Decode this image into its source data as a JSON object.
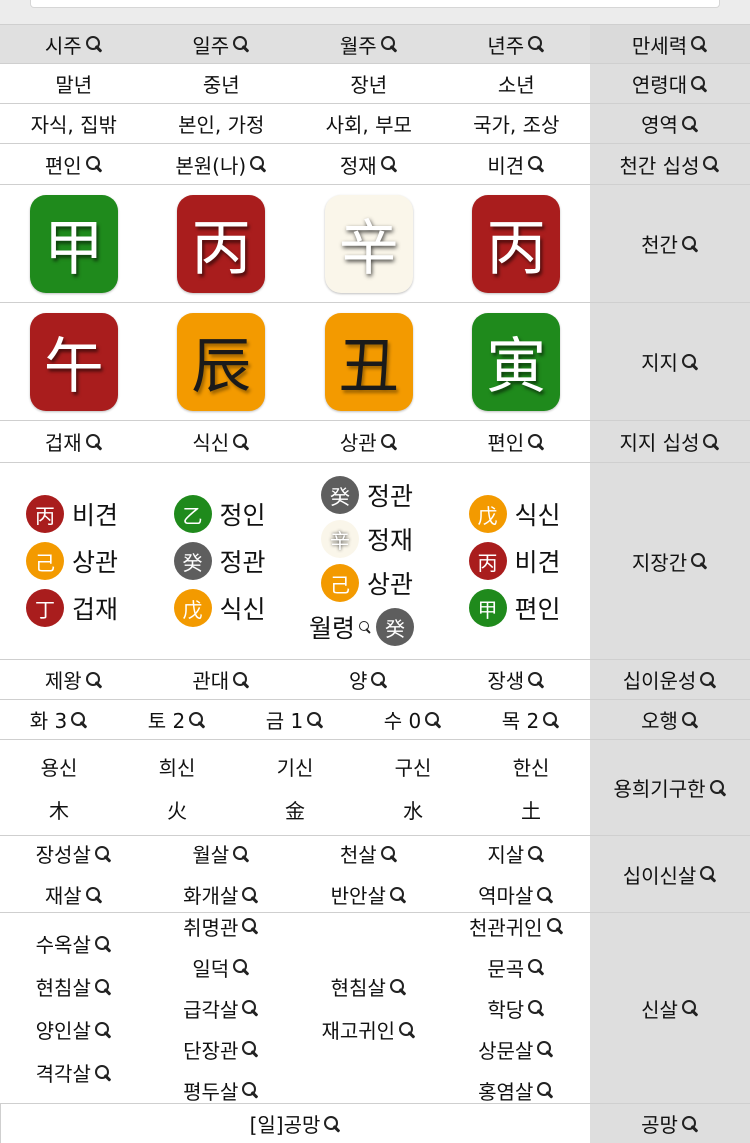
{
  "header": {
    "labels": [
      "시주",
      "일주",
      "월주",
      "년주"
    ],
    "side": "만세력"
  },
  "age": {
    "labels": [
      "말년",
      "중년",
      "장년",
      "소년"
    ],
    "side": "연령대"
  },
  "domain": {
    "labels": [
      "자식, 집밖",
      "본인, 가정",
      "사회, 부모",
      "국가, 조상"
    ],
    "side": "영역"
  },
  "stem_sipsung": {
    "labels": [
      "편인",
      "본원(나)",
      "정재",
      "비견"
    ],
    "side": "천간 십성"
  },
  "stems": {
    "chars": [
      "甲",
      "丙",
      "辛",
      "丙"
    ],
    "colors": [
      "green",
      "red",
      "white",
      "red"
    ],
    "side": "천간"
  },
  "branches": {
    "chars": [
      "午",
      "辰",
      "丑",
      "寅"
    ],
    "colors": [
      "red",
      "orange",
      "orange",
      "green"
    ],
    "side": "지지"
  },
  "branch_sipsung": {
    "labels": [
      "겁재",
      "식신",
      "상관",
      "편인"
    ],
    "side": "지지 십성"
  },
  "jijanggan": {
    "side": "지장간",
    "columns": [
      [
        {
          "char": "丙",
          "color": "red",
          "label": "비견"
        },
        {
          "char": "己",
          "color": "orange",
          "label": "상관"
        },
        {
          "char": "丁",
          "color": "red",
          "label": "겁재"
        }
      ],
      [
        {
          "char": "乙",
          "color": "green",
          "label": "정인"
        },
        {
          "char": "癸",
          "color": "gray",
          "label": "정관"
        },
        {
          "char": "戊",
          "color": "orange",
          "label": "식신"
        }
      ],
      [
        {
          "char": "癸",
          "color": "gray",
          "label": "정관"
        },
        {
          "char": "辛",
          "color": "white",
          "label": "정재"
        },
        {
          "char": "己",
          "color": "orange",
          "label": "상관"
        }
      ],
      [
        {
          "char": "戊",
          "color": "orange",
          "label": "식신"
        },
        {
          "char": "丙",
          "color": "red",
          "label": "비견"
        },
        {
          "char": "甲",
          "color": "green",
          "label": "편인"
        }
      ]
    ],
    "wolryeong": {
      "label": "월령",
      "char": "癸",
      "color": "gray"
    }
  },
  "twelve_stages": {
    "labels": [
      "제왕",
      "관대",
      "양",
      "장생"
    ],
    "side": "십이운성"
  },
  "five_elements": {
    "labels": [
      "화 3",
      "토 2",
      "금 1",
      "수 0",
      "목 2"
    ],
    "side": "오행"
  },
  "yonghui": {
    "side": "용희기구한",
    "headers": [
      "용신",
      "희신",
      "기신",
      "구신",
      "한신"
    ],
    "elements": [
      "木",
      "火",
      "金",
      "水",
      "土"
    ]
  },
  "twelve_sinsal": {
    "side": "십이신살",
    "columns": [
      [
        "장성살",
        "재살"
      ],
      [
        "월살",
        "화개살"
      ],
      [
        "천살",
        "반안살"
      ],
      [
        "지살",
        "역마살"
      ]
    ]
  },
  "sinsal": {
    "side": "신살",
    "columns": [
      [
        "수옥살",
        "현침살",
        "양인살",
        "격각살"
      ],
      [
        "취명관",
        "일덕",
        "급각살",
        "단장관",
        "평두살"
      ],
      [
        "현침살",
        "재고귀인"
      ],
      [
        "천관귀인",
        "문곡",
        "학당",
        "상문살",
        "홍염살"
      ]
    ]
  },
  "gongmang": {
    "value": "[일]공망",
    "side": "공망"
  },
  "colors": {
    "green": "#1f8a1c",
    "red": "#a91d1d",
    "orange": "#f39a00",
    "gray": "#5e5e5e",
    "white": "#faf6ea"
  }
}
